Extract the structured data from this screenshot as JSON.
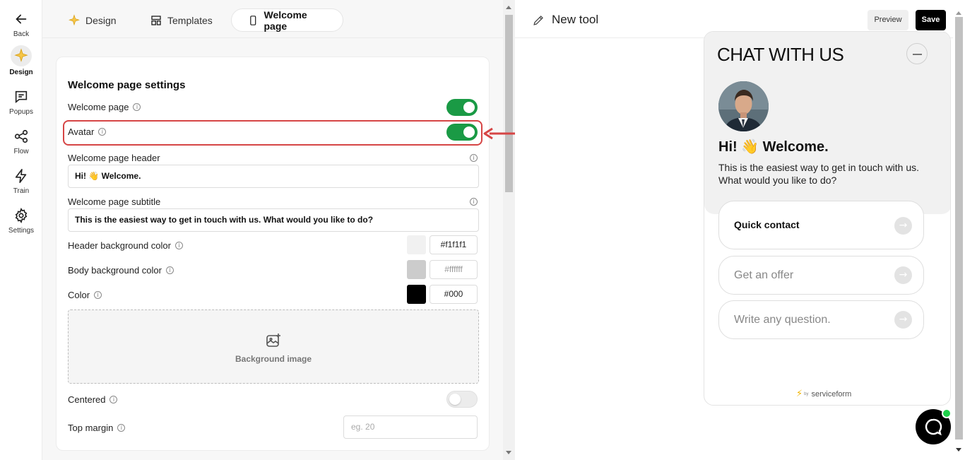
{
  "rail": {
    "back": "Back",
    "items": [
      {
        "label": "Design",
        "icon": "sparkle-icon",
        "active": true
      },
      {
        "label": "Popups",
        "icon": "chat-bubble-icon"
      },
      {
        "label": "Flow",
        "icon": "share-nodes-icon"
      },
      {
        "label": "Train",
        "icon": "lightning-icon"
      },
      {
        "label": "Settings",
        "icon": "gear-icon"
      }
    ]
  },
  "tabs": [
    {
      "label": "Design",
      "icon": "sparkle-icon"
    },
    {
      "label": "Templates",
      "icon": "templates-icon"
    },
    {
      "label": "Welcome page",
      "icon": "phone-icon",
      "active": true
    }
  ],
  "settings": {
    "title": "Welcome page settings",
    "welcome_page_label": "Welcome page",
    "avatar_label": "Avatar",
    "header_label": "Welcome page header",
    "header_value": "Hi! 👋 Welcome.",
    "subtitle_label": "Welcome page subtitle",
    "subtitle_value": "This is the easiest way to get in touch with us. What would you like to do?",
    "header_bg_label": "Header background color",
    "header_bg_value": "#f1f1f1",
    "body_bg_label": "Body background color",
    "body_bg_value": "#ffffff",
    "color_label": "Color",
    "color_value": "#000",
    "bg_image_label": "Background image",
    "centered_label": "Centered",
    "top_margin_label": "Top margin",
    "top_margin_placeholder": "eg. 20"
  },
  "preview": {
    "tool_name": "New tool",
    "preview_btn": "Preview",
    "save_btn": "Save",
    "chat_title": "CHAT WITH US",
    "welcome_header": "Hi! 👋 Welcome.",
    "welcome_sub": "This is the easiest way to get in touch with us. What would you like to do?",
    "options": [
      "Quick contact",
      "Get an offer",
      "Write any question."
    ],
    "powered_by": "by",
    "brand": "serviceform"
  },
  "colors": {
    "accent_green": "#1a9a45",
    "highlight_red": "#d64545"
  }
}
